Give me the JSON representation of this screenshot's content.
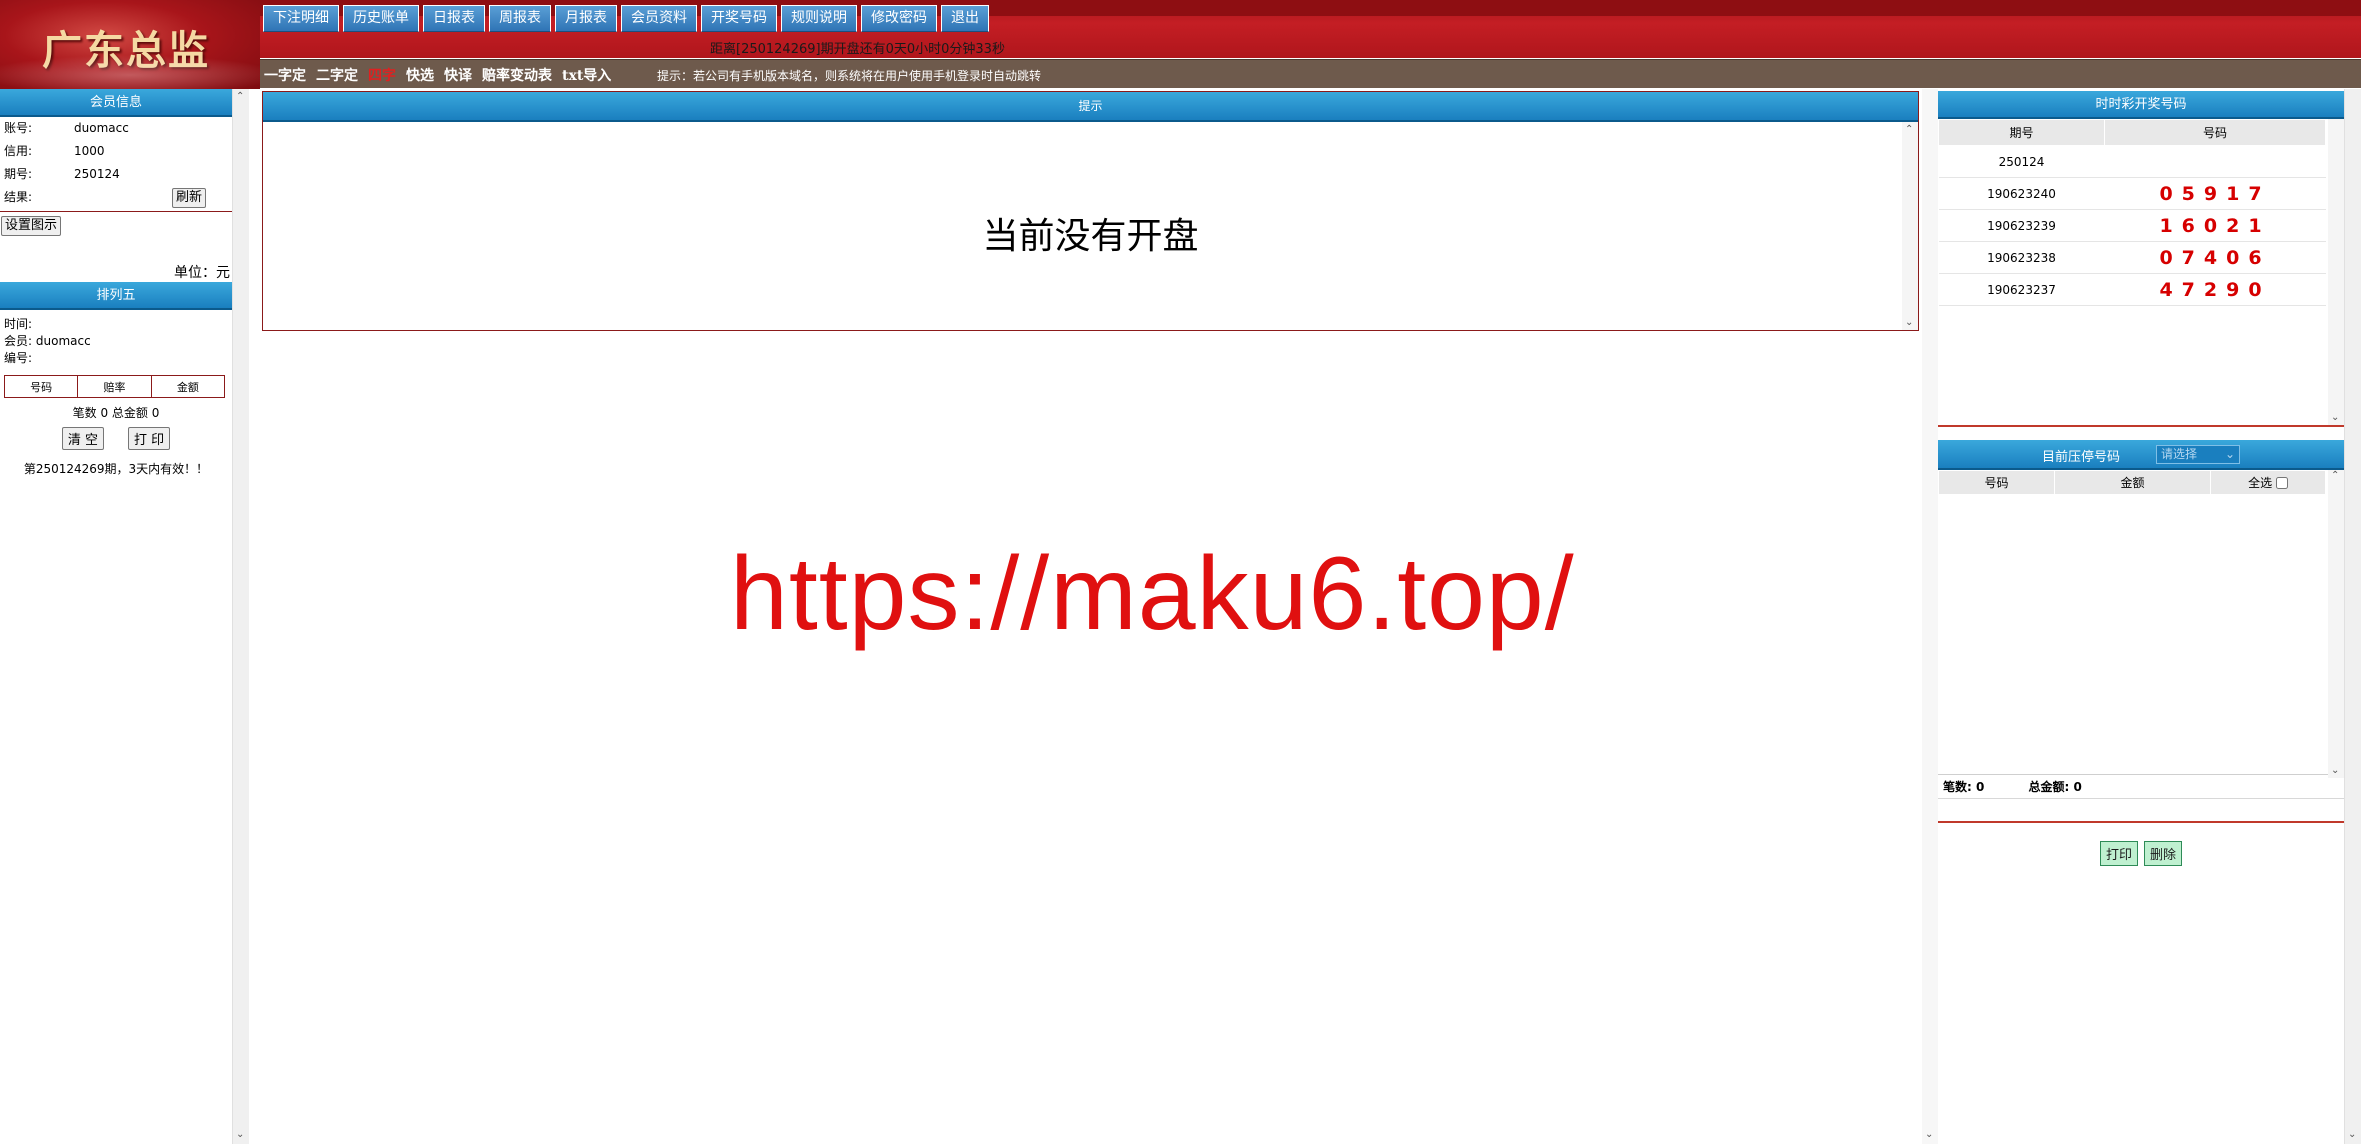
{
  "brand": {
    "title": "广东总监"
  },
  "nav": {
    "items": [
      "下注明细",
      "历史账单",
      "日报表",
      "周报表",
      "月报表",
      "会员资料",
      "开奖号码",
      "规则说明",
      "修改密码",
      "退出"
    ]
  },
  "countdown": "距离[250124269]期开盘还有0天0小时0分钟33秒",
  "subnav": {
    "items": [
      "一字定",
      "二字定",
      "四字",
      "快选",
      "快译",
      "赔率变动表",
      "txt导入"
    ],
    "active_index": 2,
    "tip": "提示：若公司有手机版本域名，则系统将在用户使用手机登录时自动跳转"
  },
  "member": {
    "title": "会员信息",
    "account_label": "账号:",
    "account": "duomacc",
    "credit_label": "信用:",
    "credit": "1000",
    "period_label": "期号:",
    "period": "250124",
    "result_label": "结果:",
    "refresh_btn": "刷新",
    "set_icon_btn": "设置图示",
    "unit": "单位：元"
  },
  "ticket": {
    "title": "排列五",
    "time_label": "时间:",
    "member_label": "会员:",
    "member": "duomacc",
    "serial_label": "编号:",
    "columns": [
      "号码",
      "赔率",
      "金额"
    ],
    "summary": "笔数 0 总金额 0",
    "clear_btn": "清 空",
    "print_btn": "打 印",
    "validity": "第250124269期，3天内有效！！"
  },
  "notice": {
    "title": "提示",
    "message": "当前没有开盘"
  },
  "watermark": "https://maku6.top/",
  "results": {
    "title": "时时彩开奖号码",
    "columns": [
      "期号",
      "号码"
    ],
    "rows": [
      {
        "period": "250124",
        "numbers": ""
      },
      {
        "period": "190623240",
        "numbers": "05917"
      },
      {
        "period": "190623239",
        "numbers": "16021"
      },
      {
        "period": "190623238",
        "numbers": "07406"
      },
      {
        "period": "190623237",
        "numbers": "47290"
      }
    ]
  },
  "stopped": {
    "title": "目前压停号码",
    "select_placeholder": "请选择",
    "columns": [
      "号码",
      "金额",
      "全选"
    ],
    "count_label": "笔数: 0",
    "total_label": "总金额: 0",
    "print_btn": "打印",
    "delete_btn": "删除"
  },
  "colors": {
    "header_red": "#c41e24",
    "nav_blue": "#2f74b5",
    "panel_blue": "#1a7fbf",
    "subbar_brown": "#6e5a4c",
    "result_red": "#d60000",
    "watermark_red": "#e01010"
  }
}
